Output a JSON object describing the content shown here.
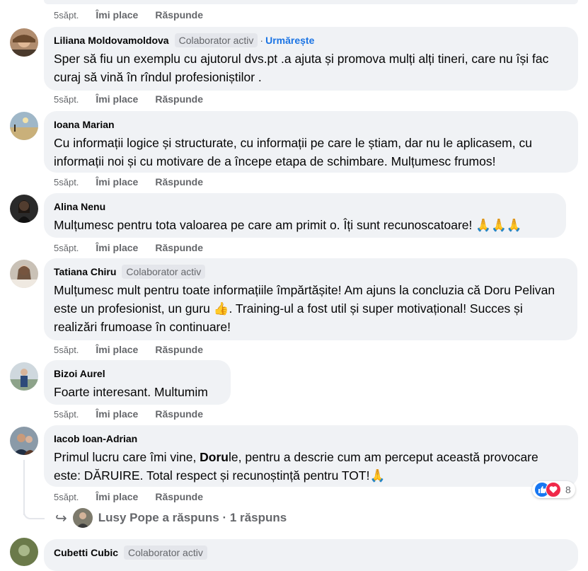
{
  "top_actions": {
    "time": "5săpt.",
    "like": "Îmi place",
    "reply": "Răspunde"
  },
  "comments": [
    {
      "name": "Liliana Moldovamoldova",
      "badge": "Colaborator activ",
      "dot": "·",
      "follow": "Urmărește",
      "text": "Sper să fiu un exemplu cu ajutorul dvs.pt .a ajuta și promova mulți alți tineri, care nu își fac curaj să vină în rîndul profesioniștilor .",
      "time": "5săpt.",
      "like": "Îmi place",
      "reply": "Răspunde"
    },
    {
      "name": "Ioana Marian",
      "text": "Cu informații logice și structurate, cu informații pe care le știam, dar nu le aplicasem, cu informații noi și cu motivare de a începe etapa de schimbare. Mulțumesc frumos!",
      "time": "5săpt.",
      "like": "Îmi place",
      "reply": "Răspunde"
    },
    {
      "name": "Alina Nenu",
      "text": "Mulțumesc pentru tota valoarea pe care am primit o. Îți sunt recunoscatoare! 🙏🙏🙏",
      "time": "5săpt.",
      "like": "Îmi place",
      "reply": "Răspunde"
    },
    {
      "name": "Tatiana Chiru",
      "badge": "Colaborator activ",
      "text": "Mulțumesc mult pentru toate informațiile împărtășite! Am ajuns la concluzia că Doru Pelivan este un profesionist, un guru 👍. Training-ul a fost util și super motivațional! Succes și realizări frumoase în continuare!",
      "time": "5săpt.",
      "like": "Îmi place",
      "reply": "Răspunde"
    },
    {
      "name": "Bizoi Aurel",
      "text": "Foarte interesant. Multumim",
      "time": "5săpt.",
      "like": "Îmi place",
      "reply": "Răspunde"
    },
    {
      "name": "Iacob Ioan-Adrian",
      "text_pre": "Primul lucru care îmi vine, ",
      "text_bold": "Doru",
      "text_post": "le, pentru a descrie cum am perceput această provocare este: DĂRUIRE. Total respect și recunoștință pentru TOT!🙏",
      "time": "5săpt.",
      "like": "Îmi place",
      "reply": "Răspunde",
      "reaction_count": "8"
    },
    {
      "name": "Cubetti Cubic",
      "badge": "Colaborator activ"
    }
  ],
  "reply_summary": {
    "arrow": "↪",
    "text": "Lusy Pope a răspuns · 1 răspuns"
  },
  "icons": {
    "like": "like-icon",
    "love": "love-icon",
    "reply": "reply-arrow-icon"
  },
  "colors": {
    "bubble": "#f0f2f5",
    "follow": "#1b74e4",
    "like": "#1877f2",
    "love": "#f02849",
    "muted": "#65676b"
  }
}
